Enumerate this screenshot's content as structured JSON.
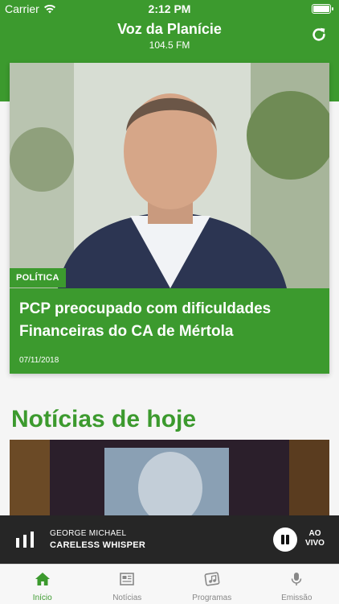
{
  "status_bar": {
    "carrier": "Carrier",
    "time": "2:12 PM"
  },
  "header": {
    "title": "Voz da Planície",
    "subtitle": "104.5 FM",
    "refresh_icon": "refresh-icon"
  },
  "featured": {
    "category": "POLÍTICA",
    "headline": "PCP preocupado com dificuldades Financeiras do CA de Mértola",
    "date": "07/11/2018"
  },
  "section": {
    "title": "Notícias de hoje"
  },
  "player": {
    "artist": "GEORGE MICHAEL",
    "song": "CARELESS WHISPER",
    "live_label_1": "AO",
    "live_label_2": "VIVO"
  },
  "tabs": [
    {
      "label": "Início",
      "icon": "home-icon",
      "active": true
    },
    {
      "label": "Notícias",
      "icon": "newspaper-icon",
      "active": false
    },
    {
      "label": "Programas",
      "icon": "music-notes-icon",
      "active": false
    },
    {
      "label": "Emissão",
      "icon": "microphone-icon",
      "active": false
    }
  ],
  "colors": {
    "brand": "#3c9a2e"
  }
}
